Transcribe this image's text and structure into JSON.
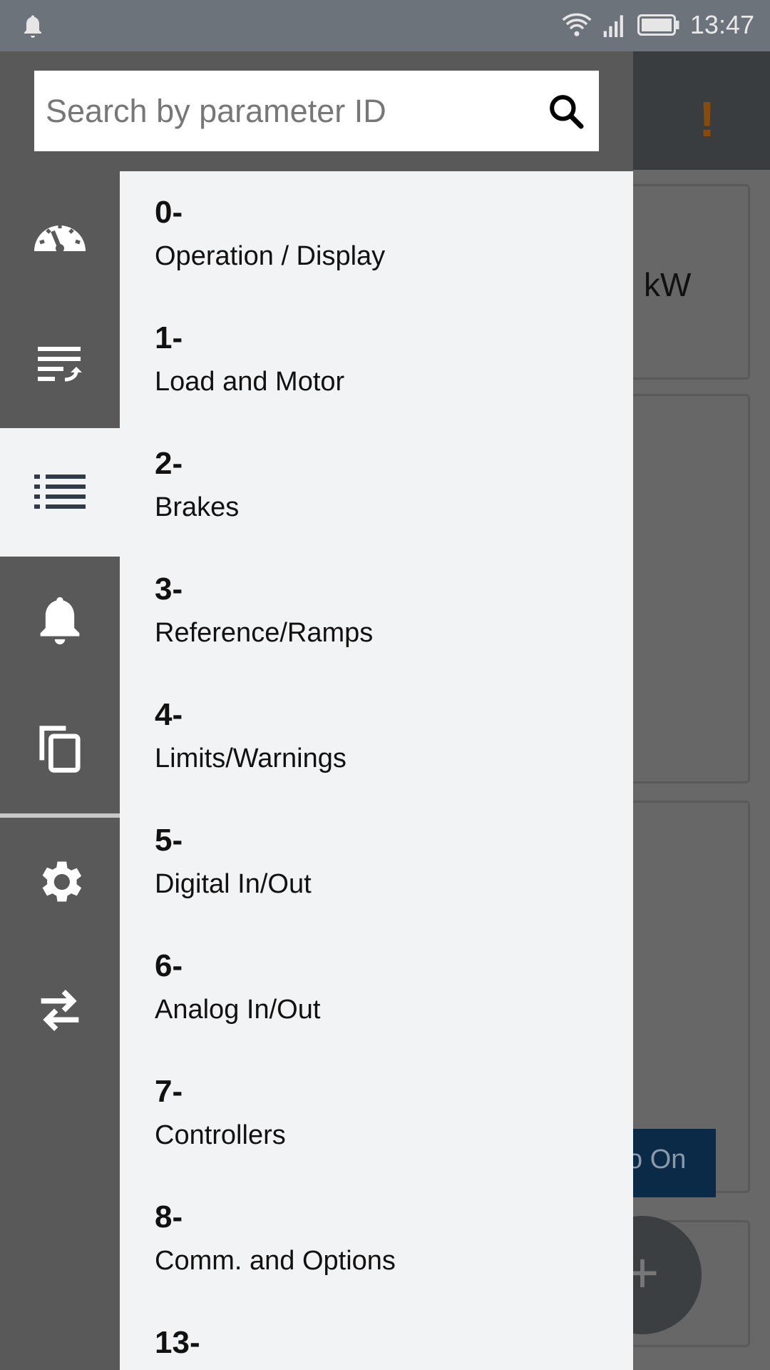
{
  "status_bar": {
    "time": "13:47",
    "icons": [
      "notification-bell-icon",
      "wifi-icon",
      "signal-icon",
      "battery-icon"
    ]
  },
  "background": {
    "unit": "kW",
    "tooltip": "o On",
    "fab": "+",
    "warning": "!"
  },
  "search": {
    "placeholder": "Search by parameter ID",
    "value": ""
  },
  "rail": {
    "items": [
      {
        "icon": "gauge-icon"
      },
      {
        "icon": "sort-list-icon"
      },
      {
        "icon": "list-icon",
        "active": true
      },
      {
        "icon": "bell-icon"
      },
      {
        "icon": "copy-icon"
      },
      {
        "icon": "gear-icon"
      },
      {
        "icon": "swap-icon"
      }
    ]
  },
  "groups": [
    {
      "num": "0-",
      "label": "Operation / Display"
    },
    {
      "num": "1-",
      "label": "Load and Motor"
    },
    {
      "num": "2-",
      "label": "Brakes"
    },
    {
      "num": "3-",
      "label": "Reference/Ramps"
    },
    {
      "num": "4-",
      "label": "Limits/Warnings"
    },
    {
      "num": "5-",
      "label": "Digital In/Out"
    },
    {
      "num": "6-",
      "label": "Analog In/Out"
    },
    {
      "num": "7-",
      "label": "Controllers"
    },
    {
      "num": "8-",
      "label": "Comm. and Options"
    },
    {
      "num": "13-",
      "label": ""
    }
  ],
  "colors": {
    "status_bar": "#6c737a",
    "drawer": "#595959",
    "list_bg": "#f2f3f5",
    "tooltip": "#0b2a48",
    "warning": "#8a4a0a"
  }
}
